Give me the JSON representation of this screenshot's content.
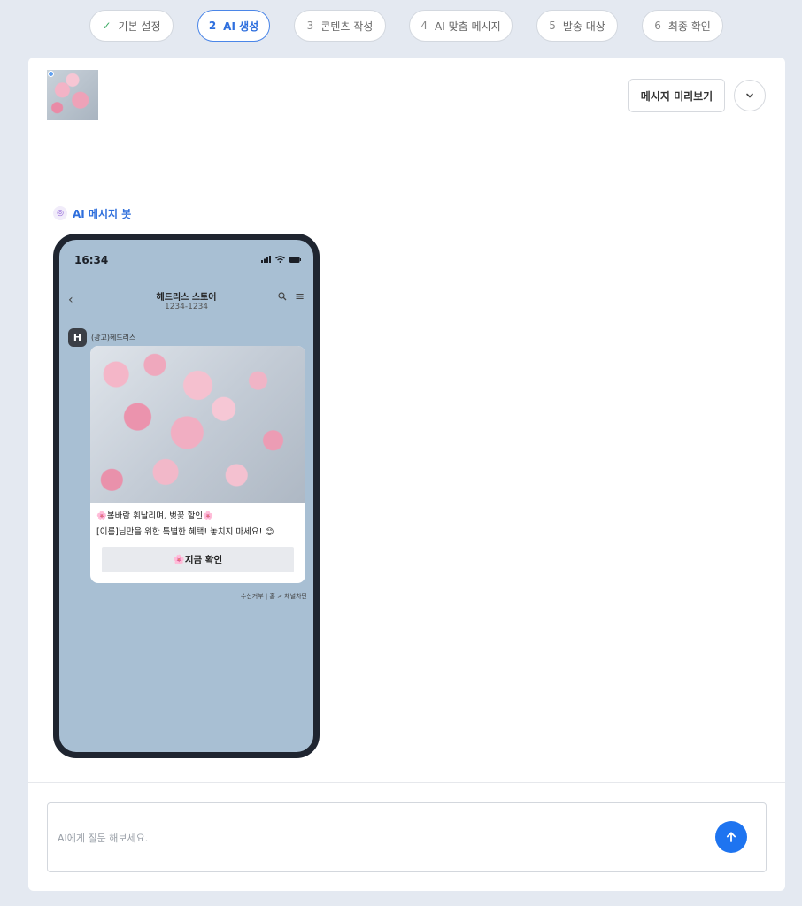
{
  "stepper": {
    "steps": [
      {
        "num": "✓",
        "label": "기본 설정",
        "state": "done"
      },
      {
        "num": "2",
        "label": "AI 생성",
        "state": "active"
      },
      {
        "num": "3",
        "label": "콘텐츠 작성",
        "state": "pending"
      },
      {
        "num": "4",
        "label": "AI 맞춤 메시지",
        "state": "pending"
      },
      {
        "num": "5",
        "label": "발송 대상",
        "state": "pending"
      },
      {
        "num": "6",
        "label": "최종 확인",
        "state": "pending"
      }
    ]
  },
  "header": {
    "preview_label": "메시지 미리보기",
    "collapse_icon": "chevron-down-icon"
  },
  "bot": {
    "label": "AI 메시지 봇"
  },
  "phone": {
    "time": "16:34",
    "store_name": "헤드리스 스토어",
    "store_number": "1234-1234",
    "sender_initial": "H",
    "sender_name": "(광고)헤드리스",
    "message_line1": "🌸봄바람 휘날리며, 벚꽃 할인🌸",
    "message_line2": "[이름]님만을 위한 특별한 혜택! 놓치지 마세요! 😊",
    "cta_label": "🌸지금 확인",
    "footer_note": "수신거부 | 홈 > 채널차단"
  },
  "ask": {
    "placeholder": "AI에게 질문 해보세요."
  },
  "colors": {
    "accent": "#1e74f0",
    "active_step": "#2e6fde",
    "done_check": "#3cab63",
    "phone_bg": "#a8bfd3"
  }
}
